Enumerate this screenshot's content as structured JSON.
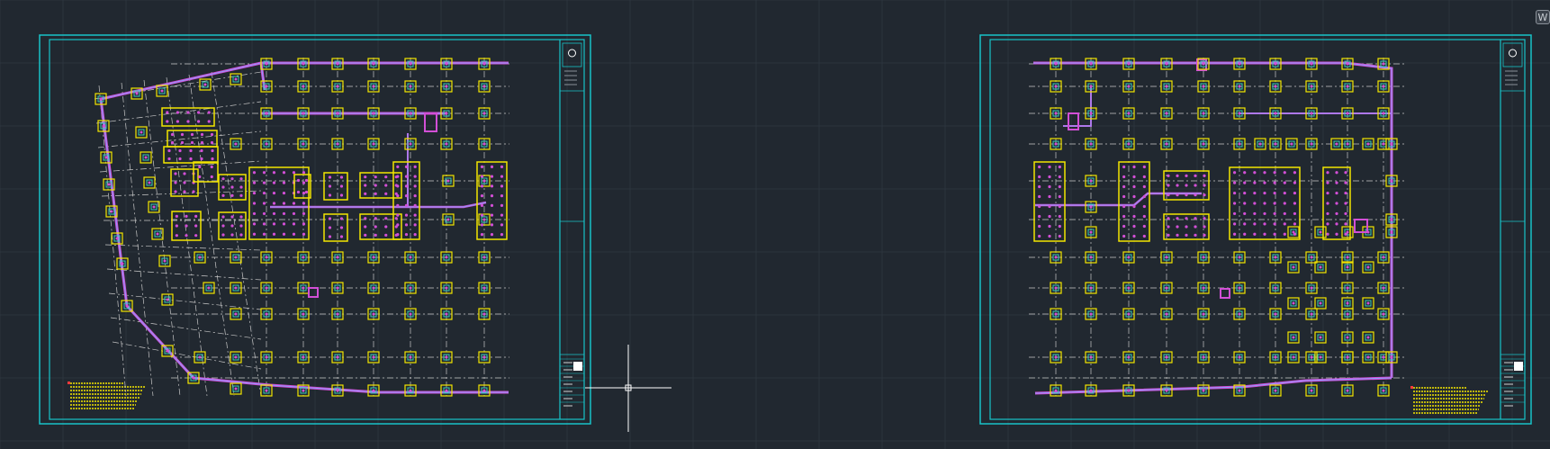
{
  "viewport": {
    "background": "#212830",
    "grid_color": "#2c343d"
  },
  "colors": {
    "frame": "#18c3c8",
    "grid_line": "#c8c8c8",
    "column": "#f2e600",
    "column_inner": "#36c9b8",
    "wall": "#d24fd6",
    "wall_core": "#8aa0ff",
    "cursor": "#ffffff"
  },
  "corner_button": {
    "label": "W"
  },
  "sheets": [
    {
      "id": "sheet-left",
      "variant": "left"
    },
    {
      "id": "sheet-right",
      "variant": "right"
    }
  ]
}
